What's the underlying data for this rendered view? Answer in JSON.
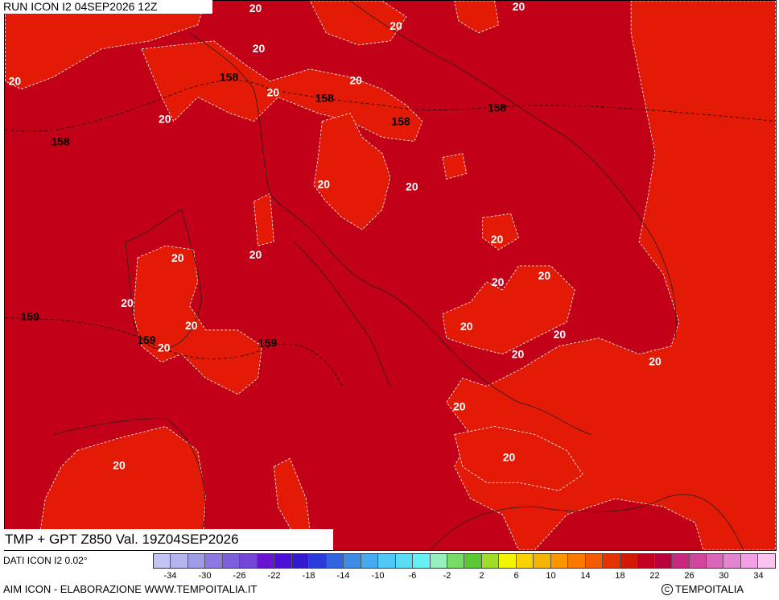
{
  "header": {
    "run_label": "RUN ICON I2 04SEP2026 12Z"
  },
  "map": {
    "title": "TMP + GPT Z850 Val. 19Z04SEP2026",
    "background_color": "#c20017",
    "warm_zone_color": "#e31a06",
    "temperature_labels": [
      "20",
      "20",
      "20",
      "20",
      "20",
      "20",
      "20",
      "20",
      "20",
      "20",
      "20",
      "20",
      "20",
      "20",
      "20",
      "20",
      "20",
      "20",
      "20",
      "20",
      "20",
      "20",
      "20",
      "20",
      "20",
      "20"
    ],
    "geopotential_labels": [
      "158",
      "158",
      "158",
      "158",
      "158",
      "159",
      "159",
      "159"
    ]
  },
  "legend": {
    "data_source": "DATI ICON I2 0.02°",
    "colors": [
      "#c3c3f5",
      "#b4b4f0",
      "#a09be6",
      "#8c78e1",
      "#7d5fdc",
      "#7346d7",
      "#6914d2",
      "#4b0fd7",
      "#3219d2",
      "#283cdc",
      "#3264e1",
      "#3c8ce6",
      "#46aaf0",
      "#50c8f5",
      "#5adcf5",
      "#64f0f5",
      "#96f0be",
      "#78dc64",
      "#5ac832",
      "#a0dc28",
      "#f5f500",
      "#fad200",
      "#f5b400",
      "#fa9600",
      "#fa7800",
      "#f55a00",
      "#e63200",
      "#d21905",
      "#c3001e",
      "#b9003c",
      "#c8287d",
      "#d2469b",
      "#dc64b9",
      "#e682d2",
      "#f5a0e6",
      "#fac3f0"
    ],
    "ticks": [
      "-34",
      "-30",
      "-26",
      "-22",
      "-18",
      "-14",
      "-10",
      "-6",
      "-2",
      "2",
      "6",
      "10",
      "14",
      "18",
      "22",
      "26",
      "30",
      "34"
    ]
  },
  "footer": {
    "source_text": "AIM ICON - ELABORAZIONE WWW.TEMPOITALIA.IT",
    "copyright_symbol": "C",
    "brand_text": "TEMPOITALIA"
  }
}
